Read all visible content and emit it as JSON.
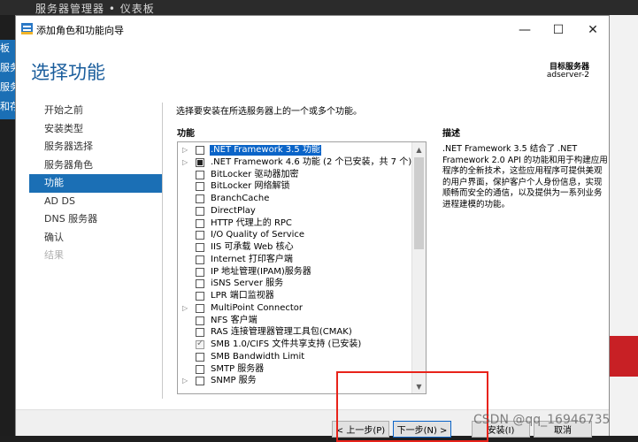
{
  "background": {
    "title_fragment": "服务器管理器 • 仪表板",
    "left_items": [
      "板",
      "服务",
      "服务",
      "和存"
    ]
  },
  "window": {
    "title": "添加角色和功能向导",
    "controls": {
      "minimize": "—",
      "maximize": "☐",
      "close": "✕"
    }
  },
  "header": {
    "page_title": "选择功能",
    "target_label": "目标服务器",
    "target_value": "adserver-2"
  },
  "nav": {
    "items": [
      {
        "label": "开始之前",
        "state": "normal"
      },
      {
        "label": "安装类型",
        "state": "normal"
      },
      {
        "label": "服务器选择",
        "state": "normal"
      },
      {
        "label": "服务器角色",
        "state": "normal"
      },
      {
        "label": "功能",
        "state": "active"
      },
      {
        "label": "AD DS",
        "state": "normal"
      },
      {
        "label": "DNS 服务器",
        "state": "normal"
      },
      {
        "label": "确认",
        "state": "normal"
      },
      {
        "label": "结果",
        "state": "disabled"
      }
    ]
  },
  "main": {
    "instruction": "选择要安装在所选服务器上的一个或多个功能。",
    "features_header": "功能",
    "description_header": "描述",
    "description": ".NET Framework 3.5 结合了 .NET Framework 2.0 API 的功能和用于构建应用程序的全新技术，这些应用程序可提供美观的用户界面，保护客户个人身份信息，实现顺畅而安全的通信，以及提供为一系列业务进程建模的功能。",
    "features": [
      {
        "label": ".NET Framework 3.5 功能",
        "expandable": true,
        "state": "unchecked",
        "selected": true
      },
      {
        "label": ".NET Framework 4.6 功能 (2 个已安装，共 7 个)",
        "expandable": true,
        "state": "partial",
        "selected": false
      },
      {
        "label": "BitLocker 驱动器加密",
        "expandable": false,
        "state": "unchecked",
        "selected": false
      },
      {
        "label": "BitLocker 网络解锁",
        "expandable": false,
        "state": "unchecked",
        "selected": false
      },
      {
        "label": "BranchCache",
        "expandable": false,
        "state": "unchecked",
        "selected": false
      },
      {
        "label": "DirectPlay",
        "expandable": false,
        "state": "unchecked",
        "selected": false
      },
      {
        "label": "HTTP 代理上的 RPC",
        "expandable": false,
        "state": "unchecked",
        "selected": false
      },
      {
        "label": "I/O Quality of Service",
        "expandable": false,
        "state": "unchecked",
        "selected": false
      },
      {
        "label": "IIS 可承载 Web 核心",
        "expandable": false,
        "state": "unchecked",
        "selected": false
      },
      {
        "label": "Internet 打印客户端",
        "expandable": false,
        "state": "unchecked",
        "selected": false
      },
      {
        "label": "IP 地址管理(IPAM)服务器",
        "expandable": false,
        "state": "unchecked",
        "selected": false
      },
      {
        "label": "iSNS Server 服务",
        "expandable": false,
        "state": "unchecked",
        "selected": false
      },
      {
        "label": "LPR 端口监视器",
        "expandable": false,
        "state": "unchecked",
        "selected": false
      },
      {
        "label": "MultiPoint Connector",
        "expandable": true,
        "state": "unchecked",
        "selected": false
      },
      {
        "label": "NFS 客户端",
        "expandable": false,
        "state": "unchecked",
        "selected": false
      },
      {
        "label": "RAS 连接管理器管理工具包(CMAK)",
        "expandable": false,
        "state": "unchecked",
        "selected": false
      },
      {
        "label": "SMB 1.0/CIFS 文件共享支持 (已安装)",
        "expandable": false,
        "state": "checked_disabled",
        "selected": false
      },
      {
        "label": "SMB Bandwidth Limit",
        "expandable": false,
        "state": "unchecked",
        "selected": false
      },
      {
        "label": "SMTP 服务器",
        "expandable": false,
        "state": "unchecked",
        "selected": false
      },
      {
        "label": "SNMP 服务",
        "expandable": true,
        "state": "unchecked",
        "selected": false
      }
    ]
  },
  "footer": {
    "prev": "< 上一步(P)",
    "next": "下一步(N) >",
    "install": "安装(I)",
    "cancel": "取消"
  },
  "watermark": "CSDN @qq_16946735",
  "colors": {
    "accent": "#1b6fb5",
    "title": "#1a5d9c",
    "selection": "#0a64c8",
    "annotation": "#e8231a"
  }
}
